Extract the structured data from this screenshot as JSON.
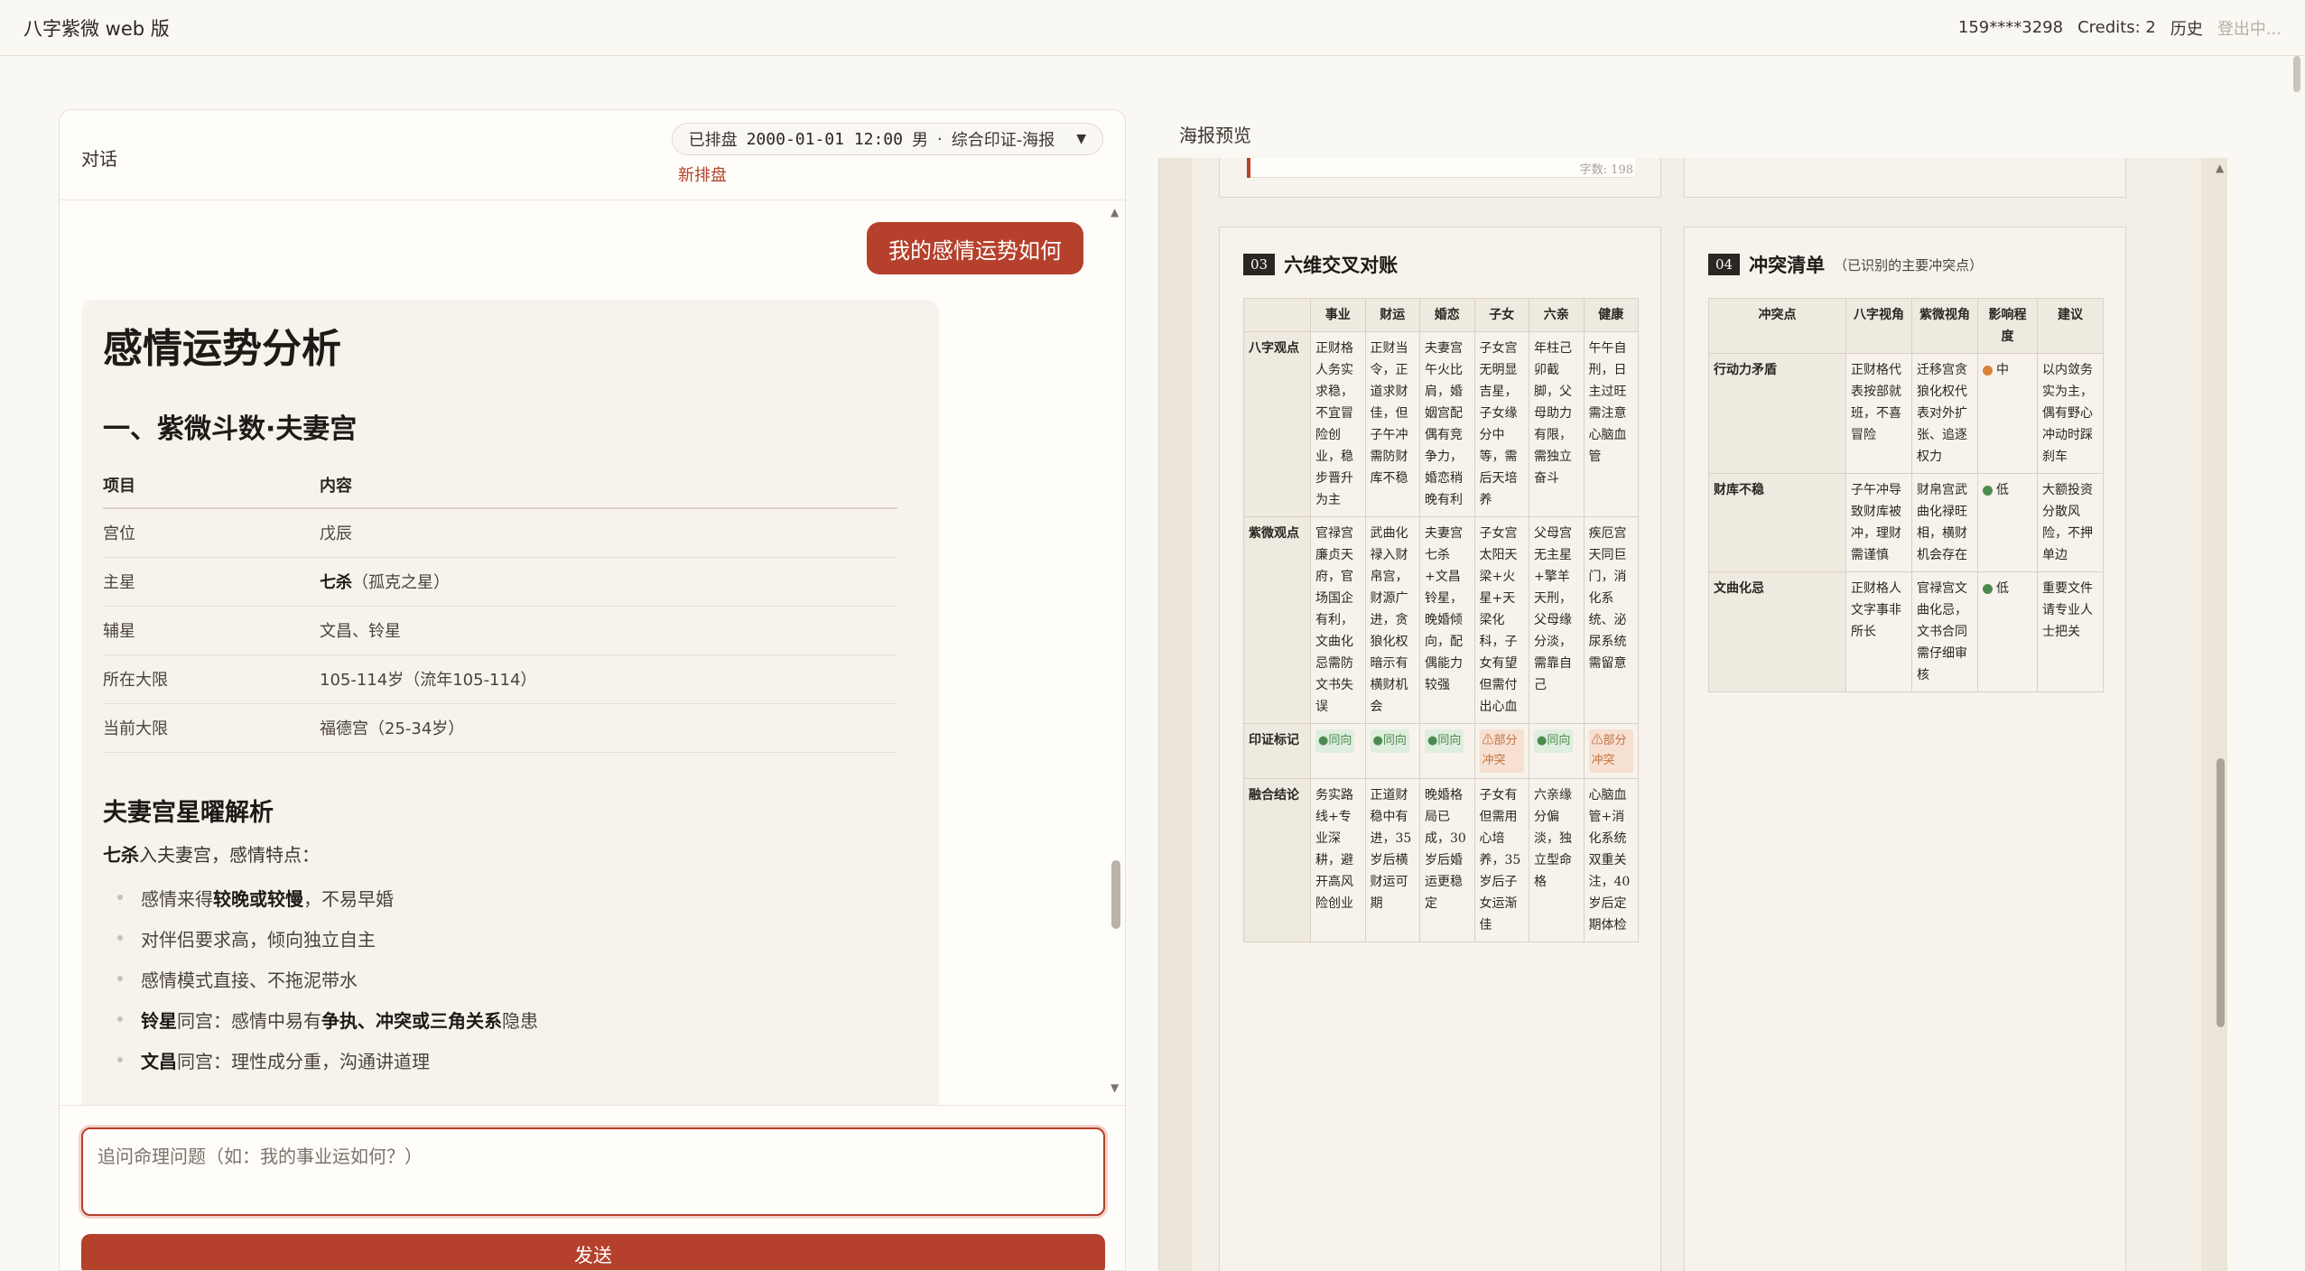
{
  "app": {
    "title": "八字紫微 web 版",
    "phone": "159****3298",
    "credits": "Credits: 2",
    "history": "历史",
    "logout": "登出中..."
  },
  "chat": {
    "title": "对话",
    "chart_status": "已排盘",
    "chart_datetime": "2000-01-01 12:00",
    "chart_gender": "男",
    "chart_sep": "·",
    "chart_mode": "综合印证-海报",
    "new_chart": "新排盘",
    "user_message": "我的感情运势如何",
    "answer": {
      "title": "感情运势分析",
      "section1": "一、紫微斗数·夫妻宫",
      "table_headers": [
        "项目",
        "内容"
      ],
      "rows": [
        {
          "k": "宫位",
          "v": "戊辰",
          "v2": ""
        },
        {
          "k": "主星",
          "v": "七杀",
          "v2": "（孤克之星）"
        },
        {
          "k": "辅星",
          "v": "文昌、铃星",
          "v2": ""
        },
        {
          "k": "所在大限",
          "v": "105-114岁（流年105-114）",
          "v2": ""
        },
        {
          "k": "当前大限",
          "v": "福德宫（25-34岁）",
          "v2": ""
        }
      ],
      "sub_title": "夫妻宫星曜解析",
      "intro_bold": "七杀",
      "intro_rest": "入夫妻宫，感情特点：",
      "bullets": [
        {
          "a": "感情来得",
          "b": "较晚或较慢",
          "c": "，不易早婚",
          "d": "",
          "e": ""
        },
        {
          "a": "对伴侣要求高，倾向独立自主",
          "b": "",
          "c": "",
          "d": "",
          "e": ""
        },
        {
          "a": "感情模式直接、不拖泥带水",
          "b": "",
          "c": "",
          "d": "",
          "e": ""
        },
        {
          "a": "",
          "b": "铃星",
          "c": "同宫：感情中易有",
          "d": "争执、冲突或三角关系",
          "e": "隐患"
        },
        {
          "a": "",
          "b": "文昌",
          "c": "同宫：理性成分重，沟通讲道理",
          "d": "",
          "e": ""
        }
      ]
    },
    "input_placeholder": "追问命理问题（如：我的事业运如何？）",
    "send_label": "发送"
  },
  "preview": {
    "label": "海报预览",
    "word_count": "字数: 198",
    "six": {
      "num": "03",
      "title": "六维交叉对账",
      "cols": [
        "",
        "事业",
        "财运",
        "婚恋",
        "子女",
        "六亲",
        "健康"
      ],
      "rows": [
        {
          "head": "八字观点",
          "cells": [
            "正财格人务实求稳，不宜冒险创业，稳步晋升为主",
            "正财当令，正道求财佳，但子午冲需防财库不稳",
            "夫妻宫午火比肩，婚姻宫配偶有竞争力，婚恋稍晚有利",
            "子女宫无明显吉星，子女缘分中等，需后天培养",
            "年柱己卯截脚，父母助力有限，需独立奋斗",
            "午午自刑，日主过旺需注意心脑血管"
          ]
        },
        {
          "head": "紫微观点",
          "cells": [
            "官禄宫廉贞天府，官场国企有利，文曲化忌需防文书失误",
            "武曲化禄入财帛宫，财源广进，贪狼化权暗示有横财机会",
            "夫妻宫七杀+文昌铃星，晚婚倾向，配偶能力较强",
            "子女宫太阳天梁+火星+天梁化科，子女有望但需付出心血",
            "父母宫无主星+擎羊天刑，父母缘分淡，需靠自己",
            "疾厄宫天同巨门，消化系统、泌尿系统需留意"
          ]
        }
      ],
      "mark_row": {
        "head": "印证标记",
        "marks": [
          {
            "type": "same",
            "icon": "●",
            "text": "同向"
          },
          {
            "type": "same",
            "icon": "●",
            "text": "同向"
          },
          {
            "type": "same",
            "icon": "●",
            "text": "同向"
          },
          {
            "type": "part",
            "icon": "⚠",
            "text": "部分冲突"
          },
          {
            "type": "same",
            "icon": "●",
            "text": "同向"
          },
          {
            "type": "part",
            "icon": "⚠",
            "text": "部分冲突"
          }
        ]
      },
      "fusion_row": {
        "head": "融合结论",
        "cells": [
          "务实路线+专业深耕，避开高风险创业",
          "正道财稳中有进，35岁后横财运可期",
          "晚婚格局已成，30岁后婚运更稳定",
          "子女有但需用心培养，35岁后子女运渐佳",
          "六亲缘分偏淡，独立型命格",
          "心脑血管+消化系统双重关注，40岁后定期体检"
        ]
      }
    },
    "conflict": {
      "num": "04",
      "title": "冲突清单",
      "subtitle": "（已识别的主要冲突点）",
      "cols": [
        "冲突点",
        "八字视角",
        "紫微视角",
        "影响程度",
        "建议"
      ],
      "rows": [
        {
          "point": "行动力矛盾",
          "bazi": "正财格代表按部就班，不喜冒险",
          "ziwei": "迁移宫贪狼化权代表对外扩张、追逐权力",
          "level": "中",
          "level_color": "#d9823b",
          "advice": "以内敛务实为主，偶有野心冲动时踩刹车"
        },
        {
          "point": "财库不稳",
          "bazi": "子午冲导致财库被冲，理财需谨慎",
          "ziwei": "财帛宫武曲化禄旺相，横财机会存在",
          "level": "低",
          "level_color": "#4c8a4f",
          "advice": "大额投资分散风险，不押单边"
        },
        {
          "point": "文曲化忌",
          "bazi": "正财格人文字事非所长",
          "ziwei": "官禄宫文曲化忌，文书合同需仔细审核",
          "level": "低",
          "level_color": "#4c8a4f",
          "advice": "重要文件请专业人士把关"
        }
      ]
    }
  }
}
